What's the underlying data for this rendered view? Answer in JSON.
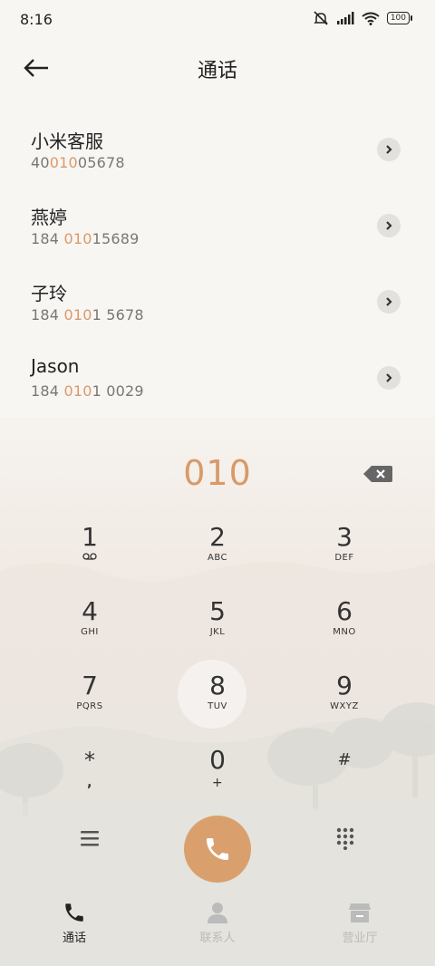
{
  "status": {
    "time": "8:16",
    "battery": "100"
  },
  "header": {
    "title": "通话"
  },
  "contacts": [
    {
      "name": "小米客服",
      "number_pre": "40",
      "number_hl": "010",
      "number_post": "05678"
    },
    {
      "name": "燕婷",
      "number_pre": "184 ",
      "number_hl": "010",
      "number_post": "15689"
    },
    {
      "name": "子玲",
      "number_pre": "184 ",
      "number_hl": "010",
      "number_post": "1 5678"
    },
    {
      "name": "Jason",
      "number_pre": "184 ",
      "number_hl": "010",
      "number_post": "1 0029"
    }
  ],
  "dial": {
    "input": "010"
  },
  "keys": [
    {
      "digit": "1",
      "letters": ""
    },
    {
      "digit": "2",
      "letters": "ABC"
    },
    {
      "digit": "3",
      "letters": "DEF"
    },
    {
      "digit": "4",
      "letters": "GHI"
    },
    {
      "digit": "5",
      "letters": "JKL"
    },
    {
      "digit": "6",
      "letters": "MNO"
    },
    {
      "digit": "7",
      "letters": "PQRS"
    },
    {
      "digit": "8",
      "letters": "TUV"
    },
    {
      "digit": "9",
      "letters": "WXYZ"
    },
    {
      "digit": "*",
      "letters": ","
    },
    {
      "digit": "0",
      "letters": "+"
    },
    {
      "digit": "#",
      "letters": ""
    }
  ],
  "tabs": [
    {
      "label": "通话",
      "icon": "phone-icon",
      "active": true
    },
    {
      "label": "联系人",
      "icon": "person-icon",
      "active": false
    },
    {
      "label": "营业厅",
      "icon": "store-icon",
      "active": false
    }
  ],
  "colors": {
    "accent": "#d99a67",
    "call": "#d9a06d"
  }
}
